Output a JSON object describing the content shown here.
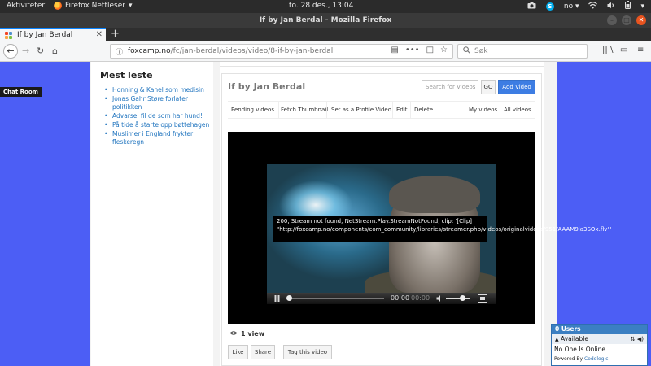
{
  "desktop": {
    "activities_label": "Aktiviteter",
    "app_menu_label": "Firefox Nettleser",
    "clock": "to. 28 des., 13:04",
    "language": "no"
  },
  "window": {
    "title": "If by Jan Berdal - Mozilla Firefox"
  },
  "tabs": [
    {
      "label": "If by Jan Berdal"
    }
  ],
  "browser": {
    "url_domain": "foxcamp.no",
    "url_path": "/fc/jan-berdal/videos/video/8-if-by-jan-berdal",
    "search_placeholder": "Søk"
  },
  "page": {
    "chat_room_tag": "Chat Room",
    "sidebar": {
      "heading": "Mest leste",
      "items": [
        "Honning & Kanel som medisin",
        "Jonas Gahr Støre forlater politikken",
        "Advarsel fil de som har hund!",
        "På tide å starte opp bøttehagen",
        "Muslimer i England frykter fleskeregn"
      ]
    },
    "video": {
      "title": "If by Jan Berdal",
      "search_placeholder": "Search for Videos",
      "go_label": "GO",
      "add_label": "Add Video",
      "menu": [
        "Pending videos",
        "Fetch Thumbnail",
        "Set as a Profile Video",
        "Edit",
        "Delete",
        "My videos",
        "All videos"
      ],
      "error_message": "200, Stream not found, NetStream.Play.StreamNotFound, clip: '[Clip] \"http://foxcamp.no/components/com_community/libraries/streamer.php/videos/originalvideos/951/AAAM9la3SOx.flv\"'",
      "time_current": "00:00",
      "time_total": "00:00",
      "views": "1 view",
      "actions": {
        "like": "Like",
        "share": "Share",
        "tag": "Tag this video"
      }
    },
    "chat_widget": {
      "header": "0 Users",
      "status": "Available",
      "empty_message": "No One Is Online",
      "powered_prefix": "Powered By",
      "powered_brand": "Codologic"
    }
  }
}
